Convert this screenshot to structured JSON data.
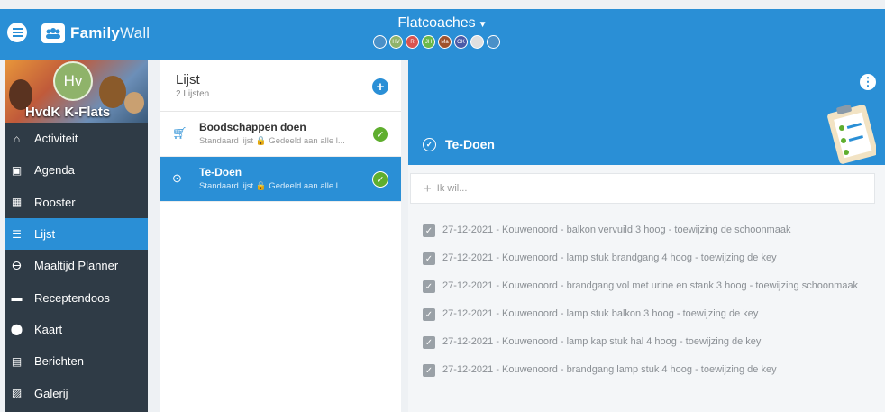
{
  "topbar": {
    "logo_short": "",
    "app_name_a": "Family",
    "app_name_b": "Wall",
    "family_name": "Flatcoaches",
    "avatars": [
      {
        "initials": "",
        "color": "#4a90c8"
      },
      {
        "initials": "HV",
        "color": "#8fb36a"
      },
      {
        "initials": "R",
        "color": "#d9534f"
      },
      {
        "initials": "JH",
        "color": "#6bb84a"
      },
      {
        "initials": "Ma",
        "color": "#a0522d"
      },
      {
        "initials": "OK",
        "color": "#4a5aa8"
      },
      {
        "initials": "",
        "color": "#e0e0e0"
      },
      {
        "initials": "",
        "color": "#4a90c8"
      }
    ]
  },
  "sidebar": {
    "avatar_initials": "Hv",
    "group_name": "HvdK K-Flats",
    "items": [
      {
        "label": "Activiteit",
        "icon": "home-icon"
      },
      {
        "label": "Agenda",
        "icon": "calendar-icon"
      },
      {
        "label": "Rooster",
        "icon": "schedule-icon"
      },
      {
        "label": "Lijst",
        "icon": "list-icon",
        "active": true
      },
      {
        "label": "Maaltijd Planner",
        "icon": "cutlery-icon"
      },
      {
        "label": "Receptendoos",
        "icon": "recipe-box-icon"
      },
      {
        "label": "Kaart",
        "icon": "map-pin-icon"
      },
      {
        "label": "Berichten",
        "icon": "message-icon"
      },
      {
        "label": "Galerij",
        "icon": "gallery-icon"
      }
    ]
  },
  "lists": {
    "title": "Lijst",
    "count": "2 Lijsten",
    "rows": [
      {
        "name": "Boodschappen doen",
        "meta": "Standaard lijst 🔒 Gedeeld aan alle l...",
        "icon": "cart-icon"
      },
      {
        "name": "Te-Doen",
        "meta": "Standaard lijst 🔒 Gedeeld aan alle l...",
        "icon": "check-circle-icon",
        "active": true
      }
    ]
  },
  "detail": {
    "title": "Te-Doen",
    "add_placeholder": "Ik wil...",
    "tasks": [
      "27-12-2021 - Kouwenoord - balkon vervuild 3 hoog - toewijzing de schoonmaak",
      "27-12-2021 - Kouwenoord - lamp stuk brandgang 4 hoog - toewijzing de key",
      "27-12-2021 - Kouwenoord - brandgang vol met urine en stank 3 hoog - toewijzing schoonmaak",
      "27-12-2021 - Kouwenoord - lamp stuk balkon 3 hoog - toewijzing de key",
      "27-12-2021 - Kouwenoord - lamp kap stuk hal 4 hoog - toewijzing de key",
      "27-12-2021 - Kouwenoord - brandgang lamp stuk 4 hoog - toewijzing de key"
    ]
  },
  "colors": {
    "primary": "#2a8fd6",
    "sidebar": "#2f3b46",
    "done_check": "#5fae2e"
  }
}
